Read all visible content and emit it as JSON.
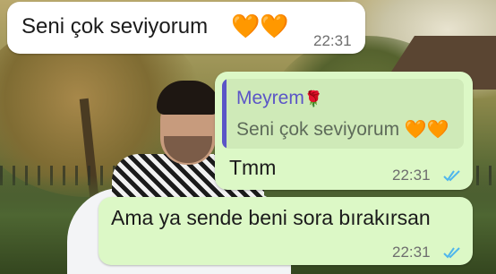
{
  "messages": [
    {
      "direction": "incoming",
      "text": "Seni çok seviyorum",
      "emoji": "🧡🧡",
      "time": "22:31"
    },
    {
      "direction": "outgoing",
      "reply_to": {
        "sender": "Meyrem",
        "sender_emoji": "🌹",
        "text": "Seni çok seviyorum",
        "emoji": "🧡🧡"
      },
      "text": "Tmm",
      "time": "22:31",
      "status_icon": "double-check-icon"
    },
    {
      "direction": "outgoing",
      "text": "Ama ya sende beni sora bırakırsan",
      "time": "22:31",
      "status_icon": "double-check-icon"
    }
  ],
  "colors": {
    "incoming_bubble": "#ffffff",
    "outgoing_bubble": "#dcf8c6",
    "quote_name": "#5b55c7",
    "read_ticks": "#4fb6ec"
  }
}
